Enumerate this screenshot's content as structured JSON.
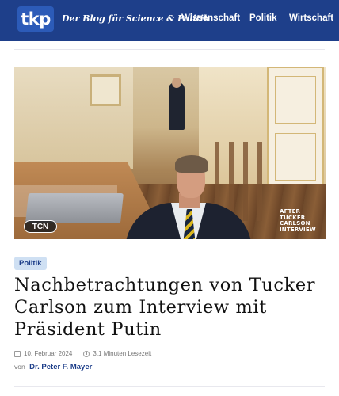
{
  "header": {
    "logo": "tkp",
    "tagline": "Der Blog für Science & Politik",
    "nav": [
      "Wissenschaft",
      "Politik",
      "Wirtschaft"
    ],
    "background_color": "#1e3f8a"
  },
  "hero": {
    "watermark_left": "TCN",
    "watermark_right_lines": [
      "AFTER",
      "TUCKER",
      "CARLSON",
      "INTERVIEW"
    ]
  },
  "article": {
    "category": "Politik",
    "title": "Nachbetrachtungen von Tucker Carlson zum Interview mit Präsident Putin",
    "date": "10. Februar 2024",
    "reading_time": "3,1 Minuten Lesezeit",
    "author_prefix": "von",
    "author": "Dr. Peter F. Mayer"
  },
  "icons": {
    "date": "calendar-icon",
    "reading_time": "clock-icon"
  }
}
